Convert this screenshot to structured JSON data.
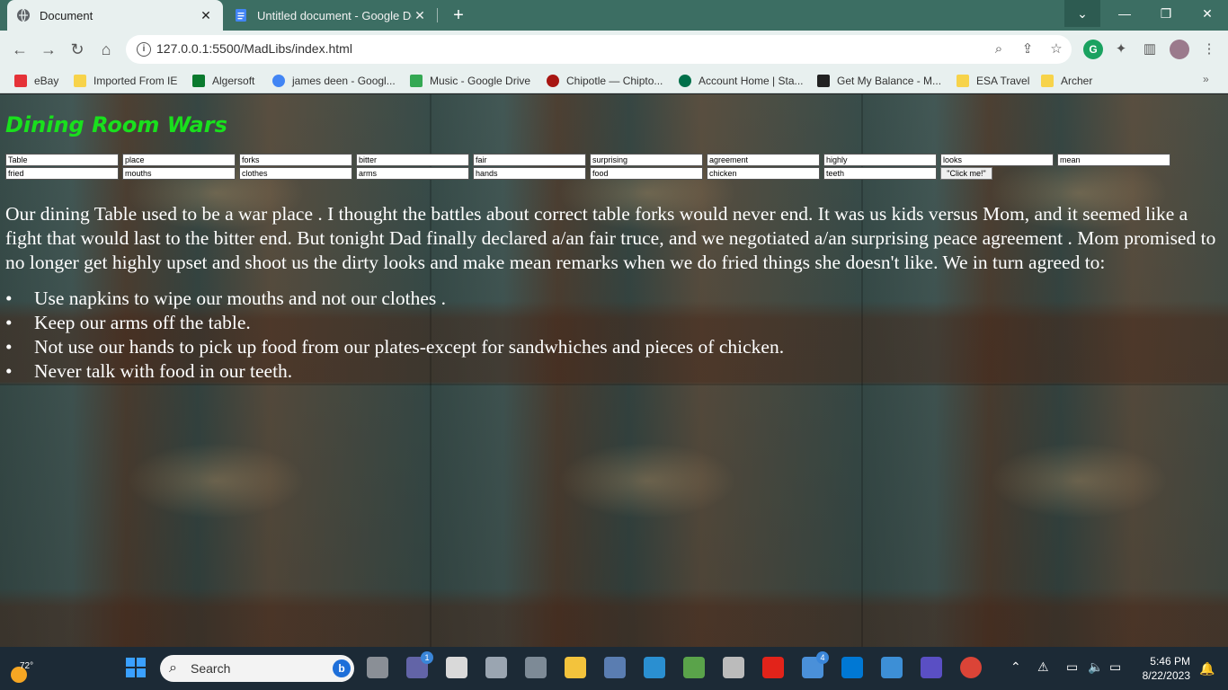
{
  "browser": {
    "tabs": [
      {
        "label": "Document",
        "active": true
      },
      {
        "label": "Untitled document - Google Doc",
        "active": false
      }
    ],
    "url": "127.0.0.1:5500/MadLibs/index.html",
    "bookmarks": [
      {
        "label": "eBay",
        "color": "#e53238"
      },
      {
        "label": "Imported From IE",
        "color": "#f7d34a"
      },
      {
        "label": "Algersoft",
        "color": "#0a7a2e"
      },
      {
        "label": "james deen - Googl...",
        "color": "#4285f4"
      },
      {
        "label": "Music - Google Drive",
        "color": "#34a853"
      },
      {
        "label": "Chipotle — Chipto...",
        "color": "#a81612"
      },
      {
        "label": "Account Home | Sta...",
        "color": "#00704a"
      },
      {
        "label": "Get My Balance - M...",
        "color": "#222222"
      },
      {
        "label": "ESA Travel",
        "color": "#f7d34a"
      },
      {
        "label": "Archer",
        "color": "#f7d34a"
      }
    ],
    "bookmarks_more": "»"
  },
  "page": {
    "title": "Dining Room Wars",
    "inputs_row1": [
      "Table",
      "place",
      "forks",
      "bitter",
      "fair",
      "surprising",
      "agreement",
      "highly",
      "looks",
      "mean"
    ],
    "inputs_row2": [
      "fried",
      "mouths",
      "clothes",
      "arms",
      "hands",
      "food",
      "chicken",
      "teeth"
    ],
    "button_label": "\"Click me!\"",
    "story_paragraph": "Our dining Table used to be a war place . I thought the battles about correct table forks would never end. It was us kids versus Mom, and it seemed like a fight that would last to the bitter end. But tonight Dad finally declared a/an fair truce, and we negotiated a/an surprising peace agreement . Mom promised to no longer get highly upset and shoot us the dirty looks and make mean remarks when we do fried things she doesn't like. We in turn agreed to:",
    "story_items": [
      "Use napkins to wipe our mouths and not our clothes .",
      "Keep our arms off the table.",
      "Not use our hands to pick up food from our plates-except for sandwhiches and pieces of chicken.",
      "Never talk with food in our teeth."
    ]
  },
  "taskbar": {
    "weather_temp": "72°",
    "search_placeholder": "Search",
    "teams_badge": "1",
    "mail_badge": "4",
    "time": "5:46 PM",
    "date": "8/22/2023"
  }
}
